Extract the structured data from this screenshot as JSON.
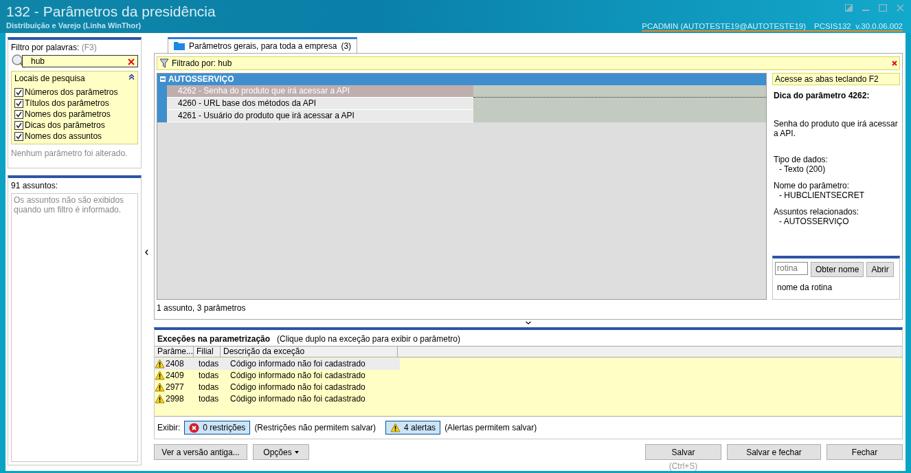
{
  "window": {
    "title": "132 - Parâmetros da presidência",
    "subtitle": "Distribuição e Varejo (Linha WinThor)",
    "user_info": "PCADMIN (AUTOTESTE19@AUTOTESTE19)",
    "module_info": "PCSIS132  v.30.0.06.002"
  },
  "filter": {
    "label": "Filtro por palavras:",
    "hotkey": "(F3)",
    "value": "hub",
    "search_places": {
      "title": "Locais de pesquisa",
      "expanded": true,
      "options": [
        {
          "label": "Números dos parâmetros",
          "checked": true
        },
        {
          "label": "Títulos dos parâmetros",
          "checked": true
        },
        {
          "label": "Nomes dos parâmetros",
          "checked": true
        },
        {
          "label": "Dicas dos parâmetros",
          "checked": true
        },
        {
          "label": "Nomes dos assuntos",
          "checked": true
        }
      ]
    },
    "status": "Nenhum parâmetro foi alterado."
  },
  "subjects": {
    "count_label": "91 assuntos:",
    "message": "Os assuntos não são exibidos quando um filtro é informado."
  },
  "tabs": [
    {
      "label": "Parâmetros gerais, para toda a empresa",
      "count": "(3)",
      "selected": true
    }
  ],
  "filter_bar": {
    "text": "Filtrado por: hub"
  },
  "groups": [
    {
      "name": "AUTOSSERVIÇO",
      "expanded": true,
      "params": [
        {
          "label": "4262 - Senha do produto que irá acessar a API",
          "selected": true
        },
        {
          "label": "4260 - URL base dos métodos da API",
          "selected": false
        },
        {
          "label": "4261 - Usuário do produto que irá acessar a API",
          "selected": false
        }
      ]
    }
  ],
  "grid_footer": "1 assunto, 3 parâmetros",
  "tip": {
    "hint": "Acesse as abas teclando F2",
    "title": "Dica do parâmetro 4262:",
    "description": "Senha do produto que irá acessar a API.",
    "sections": [
      {
        "label": "Tipo de dados:",
        "value": "- Texto (200)"
      },
      {
        "label": "Nome do parâmetro:",
        "value": "- HUBCLIENTSECRET"
      },
      {
        "label": "Assuntos relacionados:",
        "value": "- AUTOSSERVIÇO"
      }
    ]
  },
  "routine": {
    "placeholder": "rotina",
    "buttons": [
      "Obter nome",
      "Abrir"
    ],
    "caption": "nome da rotina"
  },
  "exceptions": {
    "title": "Exceções na parametrização",
    "note": "(Clique duplo na exceção para exibir o parâmetro)",
    "columns": [
      "Parâme...",
      "Filial",
      "Descrição da exceção"
    ],
    "rows": [
      {
        "param": "2408",
        "branch": "todas",
        "description": "Código informado não foi cadastrado",
        "selected": true
      },
      {
        "param": "2409",
        "branch": "todas",
        "description": "Código informado não foi cadastrado",
        "selected": false
      },
      {
        "param": "2977",
        "branch": "todas",
        "description": "Código informado não foi cadastrado",
        "selected": false
      },
      {
        "param": "2998",
        "branch": "todas",
        "description": "Código informado não foi cadastrado",
        "selected": false
      }
    ],
    "show_label": "Exibir:",
    "toggles": [
      {
        "kind": "error",
        "label": "0 restrições",
        "note": "(Restrições não permitem salvar)"
      },
      {
        "kind": "warning",
        "label": "4 alertas",
        "note": "(Alertas permitem salvar)"
      }
    ]
  },
  "left_buttons": [
    {
      "label": "Ver a versão antiga...",
      "dropdown": false
    },
    {
      "label": "Opções",
      "dropdown": true
    }
  ],
  "right_buttons": [
    {
      "label": "Salvar",
      "shortcut": "(Ctrl+S)"
    },
    {
      "label": "Salvar e fechar"
    },
    {
      "label": "Fechar"
    }
  ]
}
